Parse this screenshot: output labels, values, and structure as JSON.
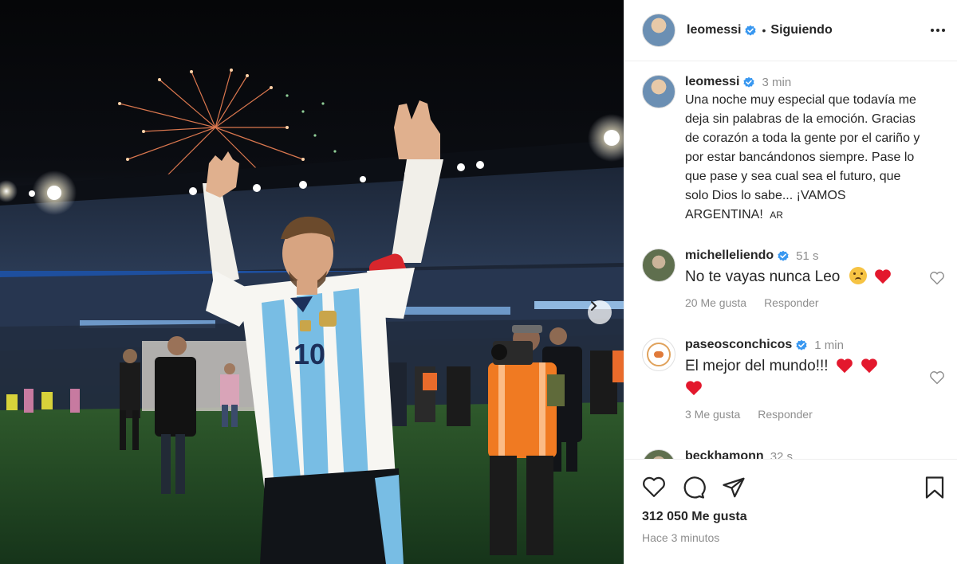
{
  "post": {
    "username": "leomessi",
    "follow_status": "Siguiendo",
    "caption": {
      "username": "leomessi",
      "time": "3 min",
      "text": "Una noche muy especial que todavía me deja sin palabras de la emoción. Gracias de corazón a toda la gente por el cariño y por estar bancándonos siempre. Pase lo que pase y sea cual sea el futuro, que solo Dios lo sabe... ¡VAMOS ARGENTINA!",
      "flag_tag": "AR"
    },
    "comments": [
      {
        "username": "michelleliendo",
        "time": "51 s",
        "text": "No te vayas nunca Leo",
        "likes": "20 Me gusta",
        "reply": "Responder"
      },
      {
        "username": "paseosconchicos",
        "time": "1 min",
        "text": "El mejor del mundo!!!",
        "likes": "3 Me gusta",
        "reply": "Responder"
      },
      {
        "username": "beckhamonn",
        "time": "32 s"
      }
    ],
    "likes_total": "312 050 Me gusta",
    "posted_ago": "Hace 3 minutos",
    "jersey_number": "10"
  },
  "icons": {
    "verified": "verified-badge-icon",
    "more": "more-options-icon",
    "like": "heart-icon",
    "comment": "comment-icon",
    "share": "share-icon",
    "save": "bookmark-icon",
    "next": "chevron-right-icon"
  },
  "colors": {
    "verified_blue": "#3897f0",
    "heart_red": "#e3182d",
    "muted_text": "#8e8e8e"
  }
}
